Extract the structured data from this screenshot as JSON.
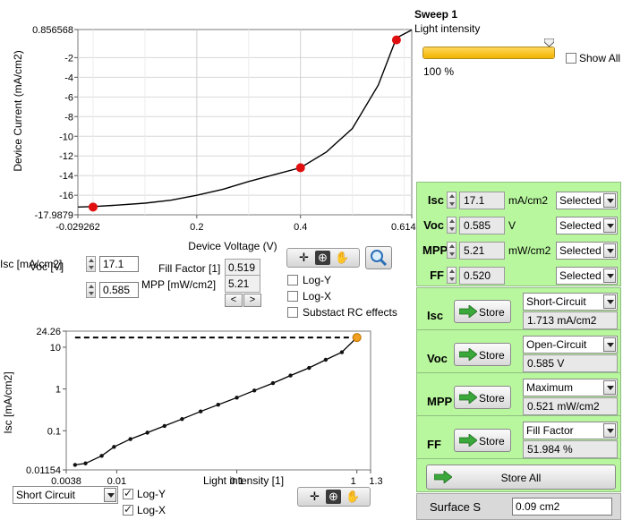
{
  "top_plot": {
    "y_axis_label": "Device Current (mA/cm2)",
    "x_axis_label": "Device Voltage (V)",
    "y_ticks": [
      "0.856568",
      "-2",
      "-4",
      "-6",
      "-8",
      "-10",
      "-12",
      "-14",
      "-16",
      "-17.9879"
    ],
    "x_ticks": [
      "-0.029262",
      "0.2",
      "0.4",
      "0.614502"
    ]
  },
  "top_controls": {
    "isc_label": "Isc [mA/cm2]",
    "isc_value": "17.1",
    "voc_label": "Voc [V]",
    "voc_value": "0.585",
    "ff_label": "Fill Factor [1]",
    "ff_value": "0.519",
    "mpp_label": "MPP [mW/cm2]",
    "mpp_value": "5.21",
    "prev_icon": "<",
    "next_icon": ">",
    "logy_label": "Log-Y",
    "logx_label": "Log-X",
    "rc_label": "Substact RC effects"
  },
  "bottom_plot": {
    "y_axis_label": "Isc [mA/cm2]",
    "x_axis_label": "Light intensity [1]",
    "y_ticks": [
      "24.26",
      "10",
      "1",
      "0.1",
      "0.01154"
    ],
    "x_ticks": [
      "0.0038",
      "0.01",
      "0.1",
      "1",
      "1.3"
    ]
  },
  "bottom_controls": {
    "mode_select": "Short Circuit",
    "logy_label": "Log-Y",
    "logx_label": "Log-X"
  },
  "sweep": {
    "title": "Sweep 1",
    "subtitle": "Light intensity",
    "value": "100 %",
    "level_percent": 100,
    "show_all_label": "Show All"
  },
  "params": [
    {
      "label": "Isc",
      "value": "17.1",
      "unit": "mA/cm2",
      "select": "Selected"
    },
    {
      "label": "Voc",
      "value": "0.585",
      "unit": "V",
      "select": "Selected"
    },
    {
      "label": "MPP",
      "value": "5.21",
      "unit": "mW/cm2",
      "select": "Selected"
    },
    {
      "label": "FF",
      "value": "0.520",
      "unit": "",
      "select": "Selected"
    }
  ],
  "store_rows": [
    {
      "label": "Isc",
      "button": "Store",
      "mode": "Short-Circuit",
      "result": "1.713 mA/cm2"
    },
    {
      "label": "Voc",
      "button": "Store",
      "mode": "Open-Circuit",
      "result": "0.585 V"
    },
    {
      "label": "MPP",
      "button": "Store",
      "mode": "Maximum",
      "result": "0.521 mW/cm2"
    },
    {
      "label": "FF",
      "button": "Store",
      "mode": "Fill Factor",
      "result": "51.984 %"
    }
  ],
  "store_all_label": "Store All",
  "surface": {
    "label": "Surface S",
    "value": "0.09 cm2"
  },
  "chart_data": [
    {
      "type": "line",
      "title": "",
      "xlabel": "Device Voltage (V)",
      "ylabel": "Device Current (mA/cm2)",
      "xlim": [
        -0.029262,
        0.614502
      ],
      "ylim": [
        -17.9879,
        0.856568
      ],
      "grid": true,
      "series": [
        {
          "x": [
            -0.029,
            0.0,
            0.05,
            0.1,
            0.15,
            0.2,
            0.25,
            0.3,
            0.35,
            0.4,
            0.45,
            0.5,
            0.55,
            0.585,
            0.614
          ],
          "y": [
            -17.2,
            -17.15,
            -17.0,
            -16.8,
            -16.5,
            -16.0,
            -15.4,
            -14.6,
            -13.9,
            -13.2,
            -11.6,
            -9.2,
            -4.8,
            0.0,
            0.8
          ]
        }
      ],
      "markers": {
        "x": [
          -0.0,
          0.4,
          0.585
        ],
        "y": [
          -17.2,
          -13.2,
          -0.2
        ]
      }
    },
    {
      "type": "line",
      "title": "",
      "xlabel": "Light intensity [1]",
      "ylabel": "Isc [mA/cm2]",
      "x_scale": "log",
      "y_scale": "log",
      "xlim": [
        0.0038,
        1.3
      ],
      "ylim": [
        0.01154,
        24.26
      ],
      "grid": false,
      "series": [
        {
          "x": [
            0.0045,
            0.0055,
            0.0075,
            0.0095,
            0.013,
            0.018,
            0.025,
            0.035,
            0.05,
            0.07,
            0.1,
            0.14,
            0.2,
            0.28,
            0.4,
            0.55,
            0.75,
            1.0
          ],
          "y": [
            0.0152,
            0.0165,
            0.025,
            0.041,
            0.063,
            0.09,
            0.13,
            0.19,
            0.29,
            0.42,
            0.62,
            0.92,
            1.38,
            2.1,
            3.2,
            5.0,
            7.6,
            17.1
          ]
        }
      ],
      "reference_line": {
        "y": 17.1,
        "x_from": 0.0045,
        "x_to": 1.0
      }
    }
  ]
}
